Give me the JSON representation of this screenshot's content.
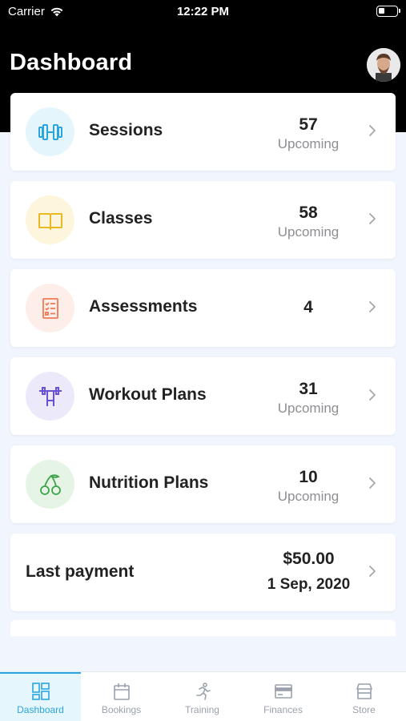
{
  "status_bar": {
    "carrier": "Carrier",
    "time": "12:22 PM",
    "battery_level": 0.35
  },
  "header": {
    "title": "Dashboard"
  },
  "cards": [
    {
      "label": "Sessions",
      "value": "57",
      "sub": "Upcoming",
      "icon": "dumbbell-icon",
      "color": "#2aa5e0",
      "bg": "#e4f6fc"
    },
    {
      "label": "Classes",
      "value": "58",
      "sub": "Upcoming",
      "icon": "book-icon",
      "color": "#e8b923",
      "bg": "#fdf6dc"
    },
    {
      "label": "Assessments",
      "value": "4",
      "sub": "",
      "icon": "checklist-icon",
      "color": "#f07a55",
      "bg": "#fdeee9"
    },
    {
      "label": "Workout Plans",
      "value": "31",
      "sub": "Upcoming",
      "icon": "barbell-icon",
      "color": "#6a4fd8",
      "bg": "#ece9fb"
    },
    {
      "label": "Nutrition Plans",
      "value": "10",
      "sub": "Upcoming",
      "icon": "cherries-icon",
      "color": "#3fa34d",
      "bg": "#e6f4e5"
    }
  ],
  "payment": {
    "label": "Last payment",
    "amount": "$50.00",
    "date": "1 Sep, 2020"
  },
  "tabs": [
    {
      "label": "Dashboard",
      "icon": "dashboard-icon",
      "active": true
    },
    {
      "label": "Bookings",
      "icon": "calendar-icon",
      "active": false
    },
    {
      "label": "Training",
      "icon": "running-icon",
      "active": false
    },
    {
      "label": "Finances",
      "icon": "credit-card-icon",
      "active": false
    },
    {
      "label": "Store",
      "icon": "store-icon",
      "active": false
    }
  ],
  "colors": {
    "accent": "#2aa5e0",
    "header_bg": "#000000",
    "page_bg": "#f1f5fd"
  }
}
